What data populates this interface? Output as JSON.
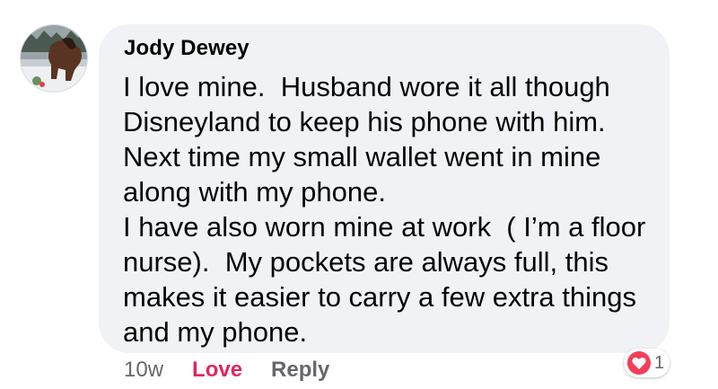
{
  "comment": {
    "author": "Jody Dewey",
    "body_lines": [
      "I love mine.  Husband wore it all though",
      "Disneyland to keep his phone with him.",
      "Next time my small wallet went in mine",
      "along with my phone.",
      "I have also worn mine at work  ( I’m a floor",
      "nurse).  My pockets are always full, this",
      "makes it easier to carry a few extra things",
      "and my phone."
    ],
    "timestamp": "10w",
    "love_label": "Love",
    "reply_label": "Reply",
    "reaction_count": "1",
    "reaction_icon": "heart-icon",
    "colors": {
      "bubble": "#f0f2f5",
      "love_text": "#e0245e",
      "love_badge": "#f33e58",
      "muted_text": "#65676b"
    }
  }
}
